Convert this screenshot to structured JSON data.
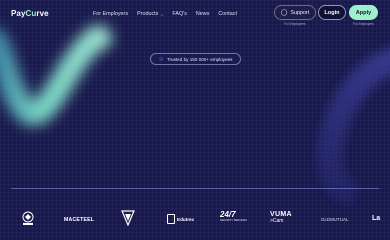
{
  "brand": {
    "name_prefix": "Pay",
    "name_accent": "Cu",
    "name_suffix": "rve"
  },
  "nav": {
    "items": [
      {
        "label": "For Employers"
      },
      {
        "label": "Products"
      },
      {
        "label": "FAQ's"
      },
      {
        "label": "News"
      },
      {
        "label": "Contact"
      }
    ]
  },
  "actions": {
    "support_label": "Support",
    "support_sub": "For Employees",
    "login_label": "Login",
    "apply_label": "Apply",
    "apply_sub": "For Employers"
  },
  "hero": {
    "badge_text": "Trusted by 150 000+ employees"
  },
  "clients": {
    "maceteel": "MACETEEL",
    "edu": "Edutrex",
    "c247_main": "24/7",
    "c247_sub": "SECURITY SERVICES",
    "vuma_main": "VUMA",
    "vuma_sub": ">Cam",
    "oldmutual": "OLDMUTUAL",
    "la": "La"
  },
  "colors": {
    "background": "#17184d",
    "accent": "#9ef0cb",
    "divider": "#8c96e6"
  },
  "icons": [
    "support-chat-icon",
    "star-icon",
    "chevron-down-icon"
  ]
}
